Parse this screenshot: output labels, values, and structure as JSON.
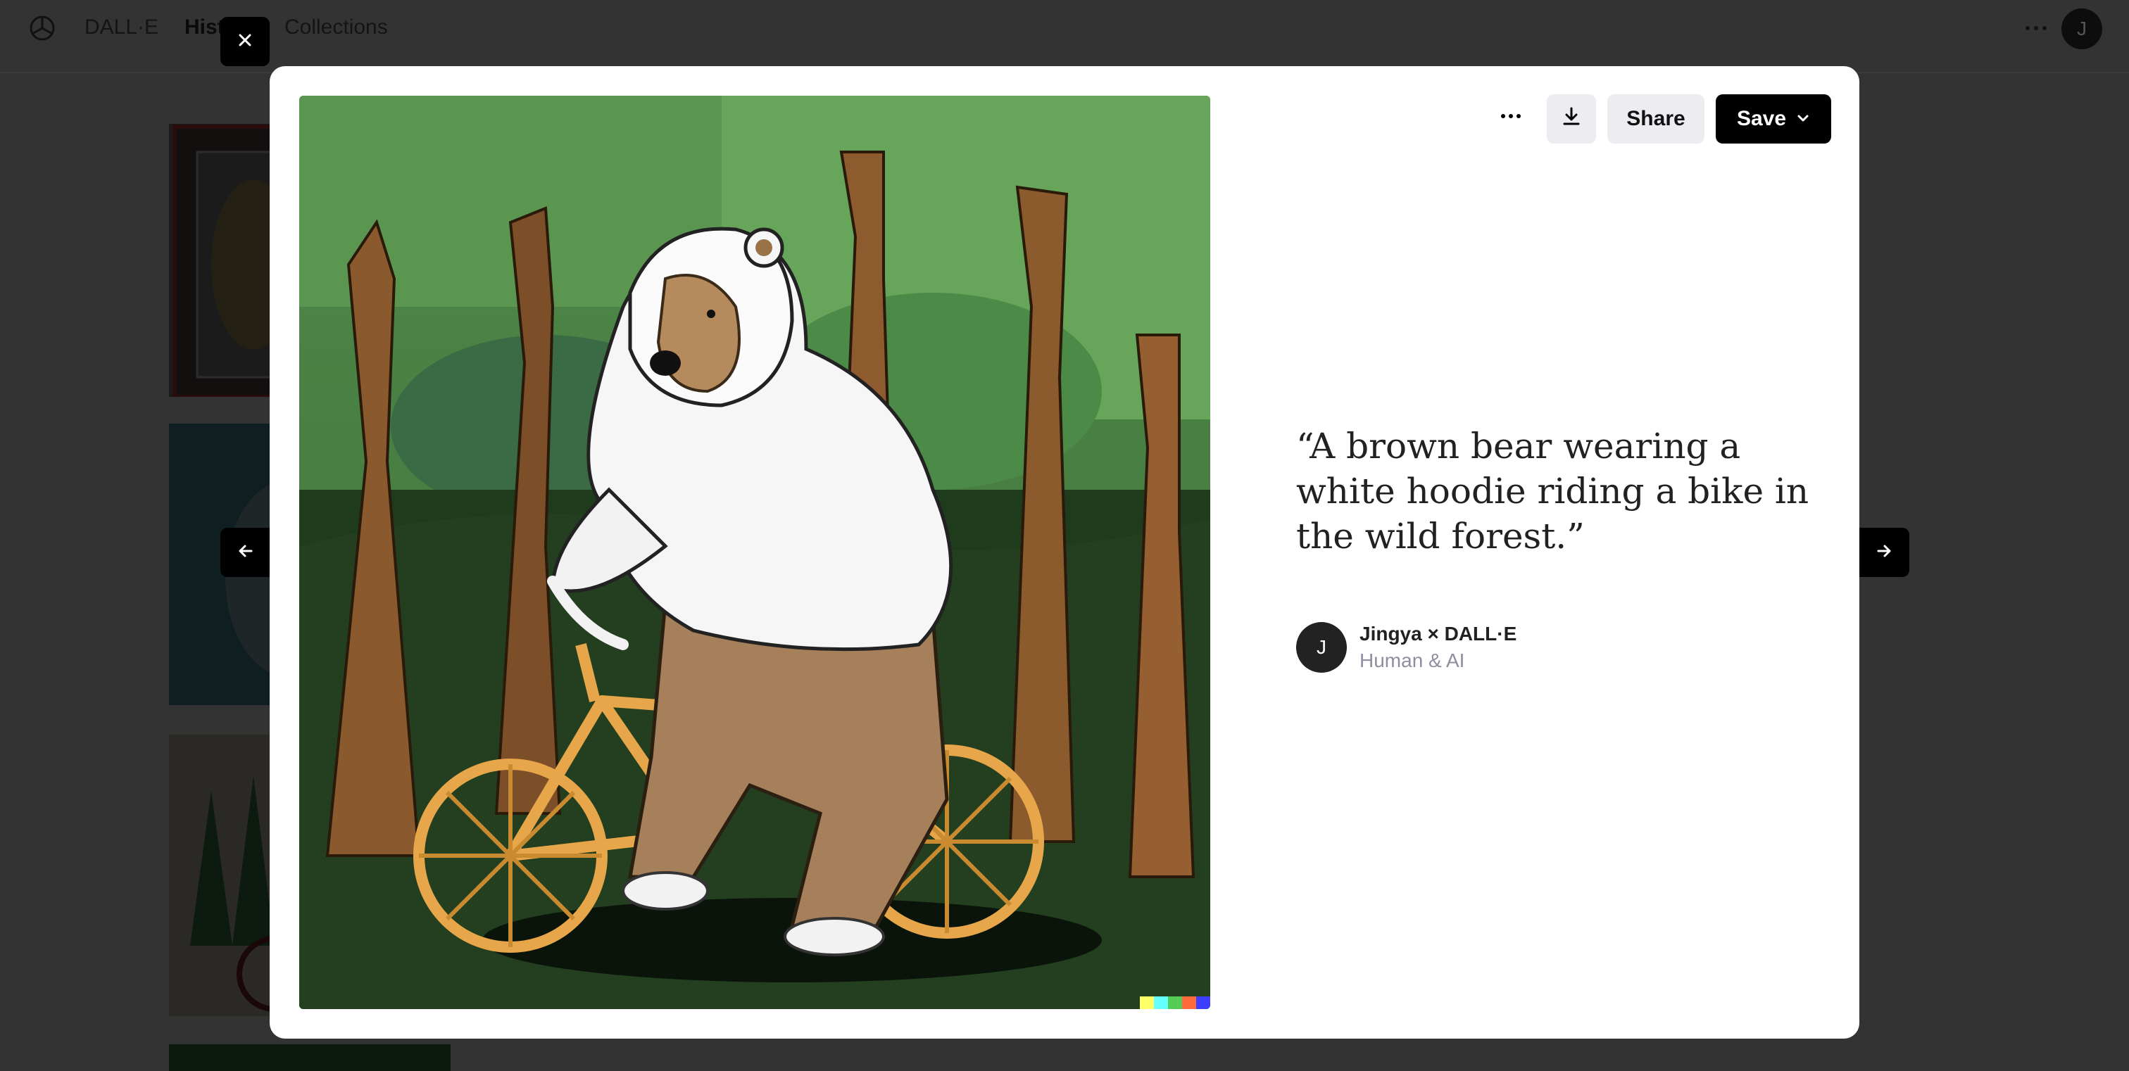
{
  "topbar": {
    "brand": "DALL·E",
    "history": "Hist",
    "collections": "Collections",
    "avatar_initial": "J"
  },
  "icons": {
    "logo": "openai-logo-icon",
    "close": "close-icon",
    "prev": "arrow-left-icon",
    "next": "arrow-right-icon",
    "more": "more-horizontal-icon",
    "download": "download-icon",
    "chevron": "chevron-down-icon"
  },
  "modal": {
    "toolbar": {
      "share_label": "Share",
      "save_label": "Save"
    },
    "prompt": "“A brown bear wearing a white hoodie riding a bike in the wild forest.”",
    "creator": {
      "initial": "J",
      "name": "Jingya × DALL·E",
      "subtitle": "Human & AI"
    }
  },
  "colors": {
    "overlay": "#333333",
    "modal_bg": "#ffffff",
    "save_bg": "#000000",
    "secondary_btn_bg": "#ececf1",
    "muted_text": "#8e8ea0"
  }
}
